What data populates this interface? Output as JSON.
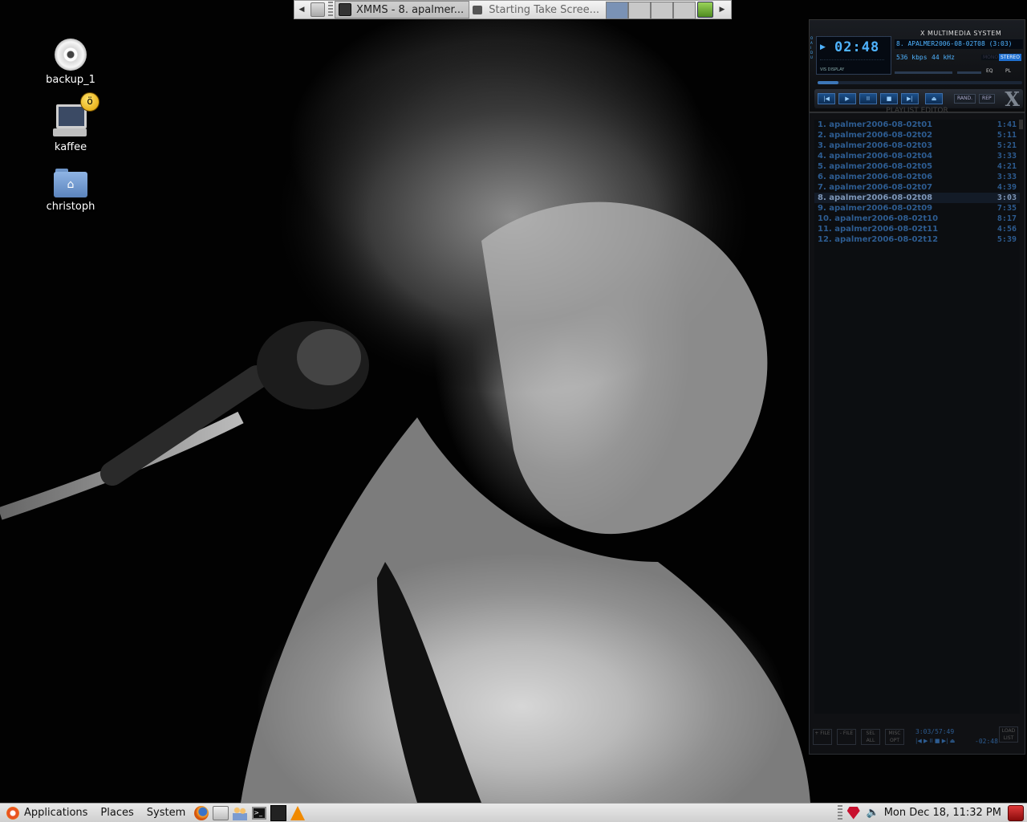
{
  "top_panel": {
    "tasks": [
      {
        "label": "XMMS - 8. apalmer..."
      },
      {
        "label": "Starting Take Scree..."
      }
    ]
  },
  "desktop": {
    "icons": [
      {
        "label": "backup_1",
        "icon": "cd-icon"
      },
      {
        "label": "kaffee",
        "icon": "computer-icon"
      },
      {
        "label": "christoph",
        "icon": "home-folder-icon"
      }
    ]
  },
  "xmms": {
    "time": "02:48",
    "system_name": "X MULTIMEDIA SYSTEM",
    "song_title": "8. APALMER2006-08-02T08 (3:03)",
    "bitrate": "536",
    "bitrate_unit": "kbps",
    "samplerate": "44",
    "samplerate_unit": "kHz",
    "mono": "MONO",
    "stereo": "STEREO",
    "vis_label": "VIS DISPLAY",
    "eq_label": "EQ",
    "pl_label": "PL",
    "seek_progress": 0.1,
    "buttons": {
      "prev": "|◀",
      "play": "▶",
      "pause": "II",
      "stop": "■",
      "next": "▶|",
      "eject": "⏏",
      "shuffle": "RAND.",
      "repeat": "REP"
    },
    "logo": "X"
  },
  "playlist": {
    "title": "PLAYLIST EDITOR",
    "items": [
      {
        "title": "1. apalmer2006-08-02t01",
        "duration": "1:41"
      },
      {
        "title": "2. apalmer2006-08-02t02",
        "duration": "5:11"
      },
      {
        "title": "3. apalmer2006-08-02t03",
        "duration": "5:21"
      },
      {
        "title": "4. apalmer2006-08-02t04",
        "duration": "3:33"
      },
      {
        "title": "5. apalmer2006-08-02t05",
        "duration": "4:21"
      },
      {
        "title": "6. apalmer2006-08-02t06",
        "duration": "3:33"
      },
      {
        "title": "7. apalmer2006-08-02t07",
        "duration": "4:39"
      },
      {
        "title": "8. apalmer2006-08-02t08",
        "duration": "3:03"
      },
      {
        "title": "9. apalmer2006-08-02t09",
        "duration": "7:35"
      },
      {
        "title": "10. apalmer2006-08-02t10",
        "duration": "8:17"
      },
      {
        "title": "11. apalmer2006-08-02t11",
        "duration": "4:56"
      },
      {
        "title": "12. apalmer2006-08-02t12",
        "duration": "5:39"
      }
    ],
    "current_index": 7,
    "footer": {
      "add": "+ FILE",
      "remove": "- FILE",
      "select": "SEL ALL",
      "misc": "MISC OPT",
      "list": "LOAD LIST",
      "total_time": "3:03/57:49",
      "play_time": "-02:48"
    }
  },
  "bottom_panel": {
    "menus": [
      "Applications",
      "Places",
      "System"
    ],
    "clock": "Mon Dec 18, 11:32 PM"
  }
}
